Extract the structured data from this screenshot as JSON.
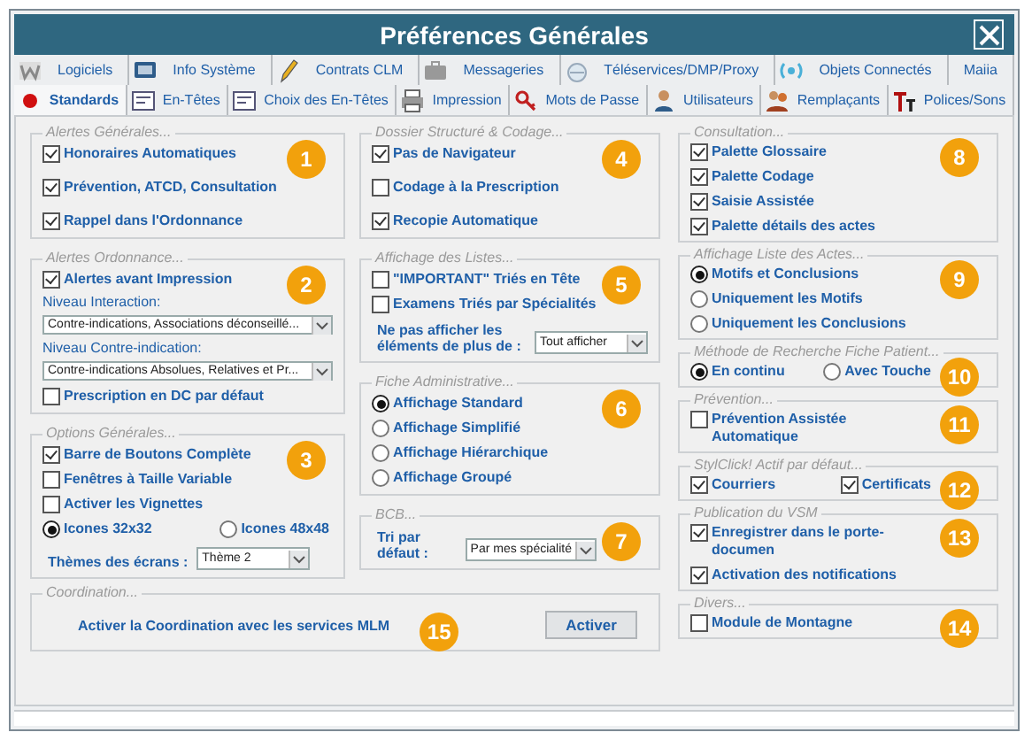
{
  "window": {
    "title": "Préférences Générales"
  },
  "tab_rows": [
    [
      {
        "label": "Logiciels",
        "selected": false
      },
      {
        "label": "Info Système",
        "selected": false
      },
      {
        "label": "Contrats CLM",
        "selected": false
      },
      {
        "label": "Messageries",
        "selected": false
      },
      {
        "label": "Téléservices/DMP/Proxy",
        "selected": false
      },
      {
        "label": "Objets Connectés",
        "selected": false
      },
      {
        "label": "Maiia",
        "selected": false
      }
    ],
    [
      {
        "label": "Standards",
        "selected": true
      },
      {
        "label": "En-Têtes",
        "selected": false
      },
      {
        "label": "Choix des En-Têtes",
        "selected": false
      },
      {
        "label": "Impression",
        "selected": false
      },
      {
        "label": "Mots de Passe",
        "selected": false
      },
      {
        "label": "Utilisateurs",
        "selected": false
      },
      {
        "label": "Remplaçants",
        "selected": false
      },
      {
        "label": "Polices/Sons",
        "selected": false
      }
    ]
  ],
  "columns": [
    [
      {
        "legend": "Alertes Générales...",
        "badge": "1",
        "items": [
          {
            "kind": "checkbox",
            "label": "Honoraires Automatiques",
            "checked": true
          },
          {
            "kind": "checkbox",
            "label": "Prévention, ATCD, Consultation",
            "checked": true
          },
          {
            "kind": "checkbox",
            "label": "Rappel dans l'Ordonnance",
            "checked": true
          }
        ]
      },
      {
        "legend": "Alertes Ordonnance...",
        "badge": "2",
        "items": [
          {
            "kind": "checkbox",
            "label": "Alertes avant Impression",
            "checked": true
          },
          {
            "kind": "caption",
            "text": "Niveau Interaction:"
          },
          {
            "kind": "select",
            "value": "Contre-indications, Associations déconseillé..."
          },
          {
            "kind": "caption",
            "text": "Niveau Contre-indication:"
          },
          {
            "kind": "select",
            "value": "Contre-indications Absolues, Relatives et Pr..."
          },
          {
            "kind": "checkbox",
            "label": "Prescription en DC par défaut",
            "checked": false
          }
        ]
      },
      {
        "legend": "Options Générales...",
        "badge": "3",
        "items": [
          {
            "kind": "checkbox",
            "label": "Barre de Boutons Complète",
            "checked": true
          },
          {
            "kind": "checkbox",
            "label": "Fenêtres à Taille Variable",
            "checked": false
          },
          {
            "kind": "checkbox",
            "label": "Activer les Vignettes",
            "checked": false
          },
          {
            "kind": "row",
            "items": [
              {
                "kind": "radio",
                "label": "Icones 32x32",
                "selected": true
              },
              {
                "kind": "radio",
                "label": "Icones 48x48",
                "selected": false
              }
            ]
          },
          {
            "kind": "labeled_select",
            "label": "Thèmes des écrans :",
            "value": "Thème 2"
          }
        ]
      }
    ],
    [
      {
        "legend": "Dossier Structuré & Codage...",
        "badge": "4",
        "items": [
          {
            "kind": "checkbox",
            "label": "Pas de Navigateur",
            "checked": true
          },
          {
            "kind": "checkbox",
            "label": "Codage à la Prescription",
            "checked": false
          },
          {
            "kind": "checkbox",
            "label": "Recopie Automatique",
            "checked": true
          }
        ]
      },
      {
        "legend": "Affichage des Listes...",
        "badge": "5",
        "items": [
          {
            "kind": "checkbox",
            "label": "\"IMPORTANT\" Triés en Tête",
            "checked": false
          },
          {
            "kind": "checkbox",
            "label": "Examens Triés par Spécialités",
            "checked": false
          },
          {
            "kind": "labeled_select",
            "label": "Ne pas afficher les éléments de plus de :",
            "value": "Tout afficher"
          }
        ]
      },
      {
        "legend": "Fiche Administrative...",
        "badge": "6",
        "items": [
          {
            "kind": "radio",
            "label": "Affichage Standard",
            "selected": true
          },
          {
            "kind": "radio",
            "label": "Affichage Simplifié",
            "selected": false
          },
          {
            "kind": "radio",
            "label": "Affichage Hiérarchique",
            "selected": false
          },
          {
            "kind": "radio",
            "label": "Affichage Groupé",
            "selected": false
          }
        ]
      },
      {
        "legend": "BCB...",
        "badge": "7",
        "items": [
          {
            "kind": "labeled_select",
            "label": "Tri par défaut :",
            "value": "Par mes spécialité"
          }
        ]
      }
    ],
    [
      {
        "legend": "Consultation...",
        "badge": "8",
        "items": [
          {
            "kind": "checkbox",
            "label": "Palette Glossaire",
            "checked": true
          },
          {
            "kind": "checkbox",
            "label": "Palette Codage",
            "checked": true
          },
          {
            "kind": "checkbox",
            "label": "Saisie Assistée",
            "checked": true
          },
          {
            "kind": "checkbox",
            "label": "Palette détails des actes",
            "checked": true
          }
        ]
      },
      {
        "legend": "Affichage Liste des Actes...",
        "badge": "9",
        "items": [
          {
            "kind": "radio",
            "label": "Motifs et Conclusions",
            "selected": true
          },
          {
            "kind": "radio",
            "label": "Uniquement les Motifs",
            "selected": false
          },
          {
            "kind": "radio",
            "label": "Uniquement les Conclusions",
            "selected": false
          }
        ]
      },
      {
        "legend": "Méthode de Recherche Fiche Patient...",
        "badge": "10",
        "items": [
          {
            "kind": "row",
            "items": [
              {
                "kind": "radio",
                "label": "En continu",
                "selected": true
              },
              {
                "kind": "radio",
                "label": "Avec Touche",
                "selected": false
              }
            ]
          }
        ]
      },
      {
        "legend": "Prévention...",
        "badge": "11",
        "items": [
          {
            "kind": "checkbox",
            "label": "Prévention Assistée Automatique",
            "checked": false
          }
        ]
      },
      {
        "legend": "StylClick! Actif par défaut...",
        "badge": "12",
        "items": [
          {
            "kind": "row",
            "items": [
              {
                "kind": "checkbox",
                "label": "Courriers",
                "checked": true
              },
              {
                "kind": "checkbox",
                "label": "Certificats",
                "checked": true
              }
            ]
          }
        ]
      },
      {
        "legend": "Publication du VSM",
        "badge": "13",
        "items": [
          {
            "kind": "checkbox",
            "label": "Enregistrer dans le porte-documen",
            "checked": true
          },
          {
            "kind": "checkbox",
            "label": "Activation des notifications",
            "checked": true
          }
        ]
      },
      {
        "legend": "Divers...",
        "badge": "14",
        "items": [
          {
            "kind": "checkbox",
            "label": "Module de Montagne",
            "checked": false
          }
        ]
      }
    ]
  ],
  "coordination": {
    "legend": "Coordination...",
    "badge": "15",
    "text": "Activer la Coordination avec les services MLM",
    "button": "Activer"
  }
}
